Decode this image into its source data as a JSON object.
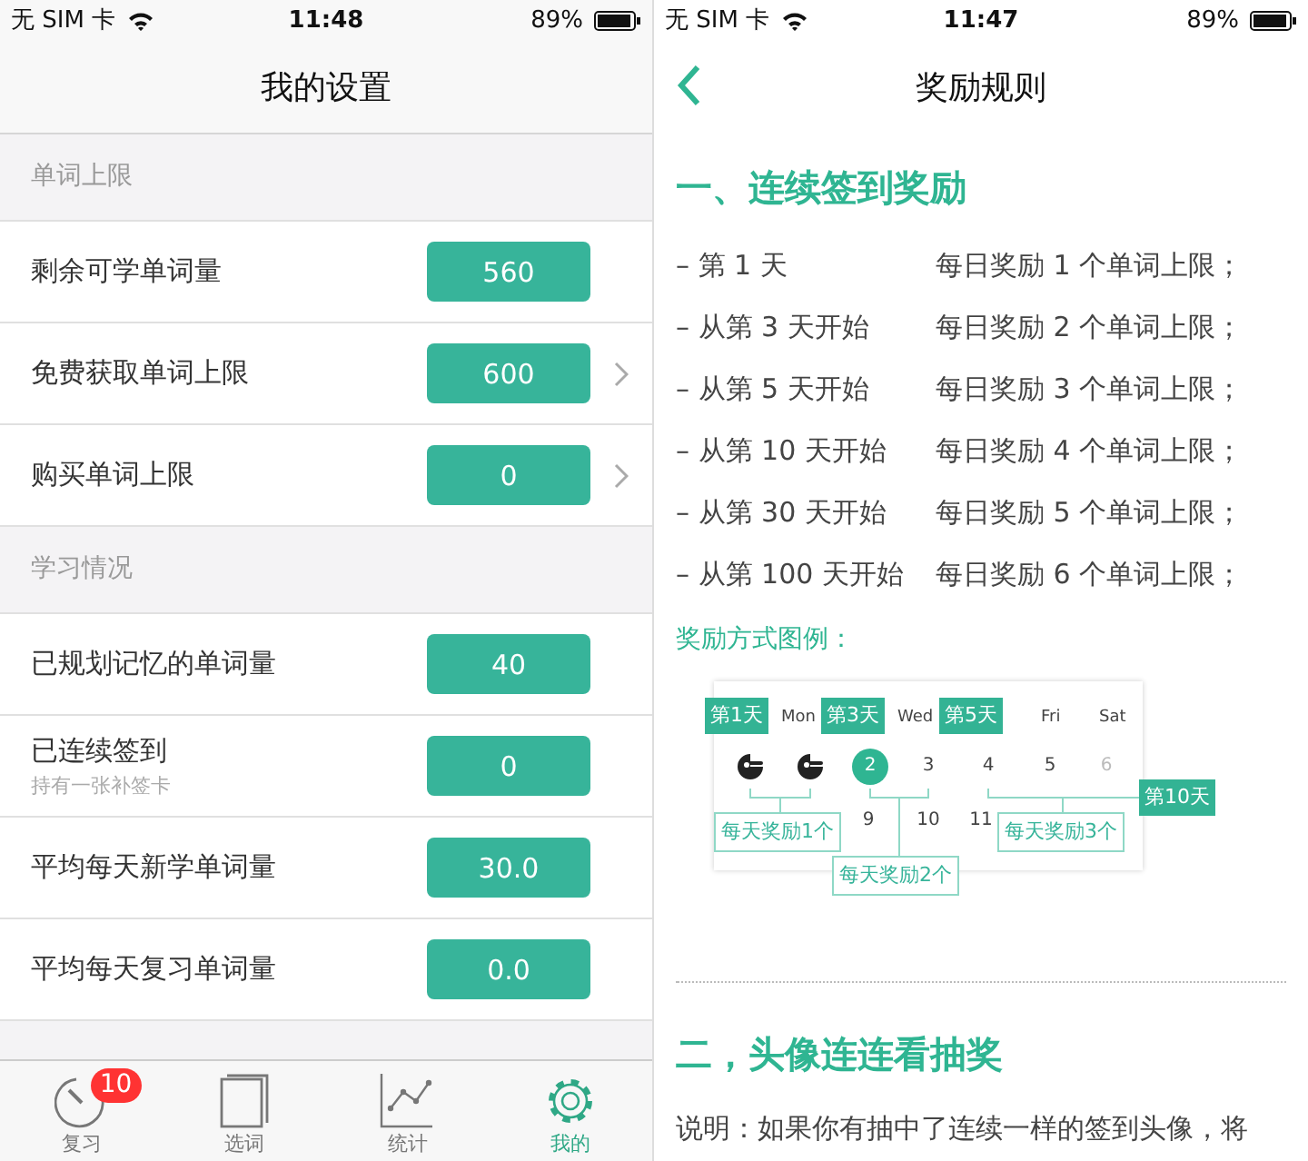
{
  "settings_screen": {
    "status_bar": {
      "carrier": "无 SIM 卡",
      "time": "11:48",
      "battery": "89%"
    },
    "title": "我的设置",
    "sections": [
      {
        "header": "单词上限",
        "rows": [
          {
            "label": "剩余可学单词量",
            "value": "560",
            "chevron": false
          },
          {
            "label": "免费获取单词上限",
            "value": "600",
            "chevron": true
          },
          {
            "label": "购买单词上限",
            "value": "0",
            "chevron": true
          }
        ]
      },
      {
        "header": "学习情况",
        "rows": [
          {
            "label": "已规划记忆的单词量",
            "value": "40",
            "chevron": false
          },
          {
            "label": "已连续签到",
            "sublabel": "持有一张补签卡",
            "value": "0",
            "chevron": false
          },
          {
            "label": "平均每天新学单词量",
            "value": "30.0",
            "chevron": false
          },
          {
            "label": "平均每天复习单词量",
            "value": "0.0",
            "chevron": false
          }
        ]
      }
    ],
    "tab_bar": [
      {
        "kind": "stopwatch",
        "label": "复习",
        "badge": "10",
        "selected": false
      },
      {
        "kind": "book",
        "label": "选词",
        "selected": false
      },
      {
        "kind": "chart",
        "label": "统计",
        "selected": false
      },
      {
        "kind": "gear",
        "label": "我的",
        "selected": true
      }
    ]
  },
  "rules_screen": {
    "status_bar": {
      "carrier": "无 SIM 卡",
      "time": "11:47",
      "battery": "89%"
    },
    "title": "奖励规则",
    "section_1": {
      "heading": "一、连续签到奖励",
      "rules": [
        {
          "day": "– 第 1 天",
          "reward": "每日奖励 1 个单词上限；"
        },
        {
          "day": "– 从第 3 天开始",
          "reward": "每日奖励 2 个单词上限；"
        },
        {
          "day": "– 从第 5 天开始",
          "reward": "每日奖励 3 个单词上限；"
        },
        {
          "day": "– 从第 10 天开始",
          "reward": "每日奖励 4 个单词上限；"
        },
        {
          "day": "– 从第 30 天开始",
          "reward": "每日奖励 5 个单词上限；"
        },
        {
          "day": "– 从第 100 天开始",
          "reward": "每日奖励 6 个单词上限；"
        }
      ],
      "legend_label": "奖励方式图例：",
      "legend": {
        "weekdays": [
          "Mon",
          "Wed",
          "Fri",
          "Sat"
        ],
        "days": [
          {
            "kind": "avatar"
          },
          {
            "kind": "avatar"
          },
          {
            "kind": "number",
            "label": "2",
            "selected": true,
            "dim": false
          },
          {
            "kind": "number",
            "label": "3",
            "selected": false,
            "dim": false
          },
          {
            "kind": "number",
            "label": "4",
            "selected": false,
            "dim": false
          },
          {
            "kind": "number",
            "label": "5",
            "selected": false,
            "dim": false
          },
          {
            "kind": "number",
            "label": "6",
            "selected": false,
            "dim": true
          },
          {
            "kind": "number",
            "label": "9",
            "selected": false,
            "dim": false
          },
          {
            "kind": "number",
            "label": "10",
            "selected": false,
            "dim": false
          },
          {
            "kind": "number",
            "label": "11",
            "selected": false,
            "dim": false
          }
        ],
        "tags": [
          "第1天",
          "第3天",
          "第5天",
          "第10天"
        ],
        "callouts": [
          "每天奖励1个",
          "每天奖励2个",
          "每天奖励3个"
        ]
      }
    },
    "section_2": {
      "heading": "二，头像连连看抽奖",
      "description": "说明：如果你有抽中了连续一样的签到头像，将"
    }
  }
}
